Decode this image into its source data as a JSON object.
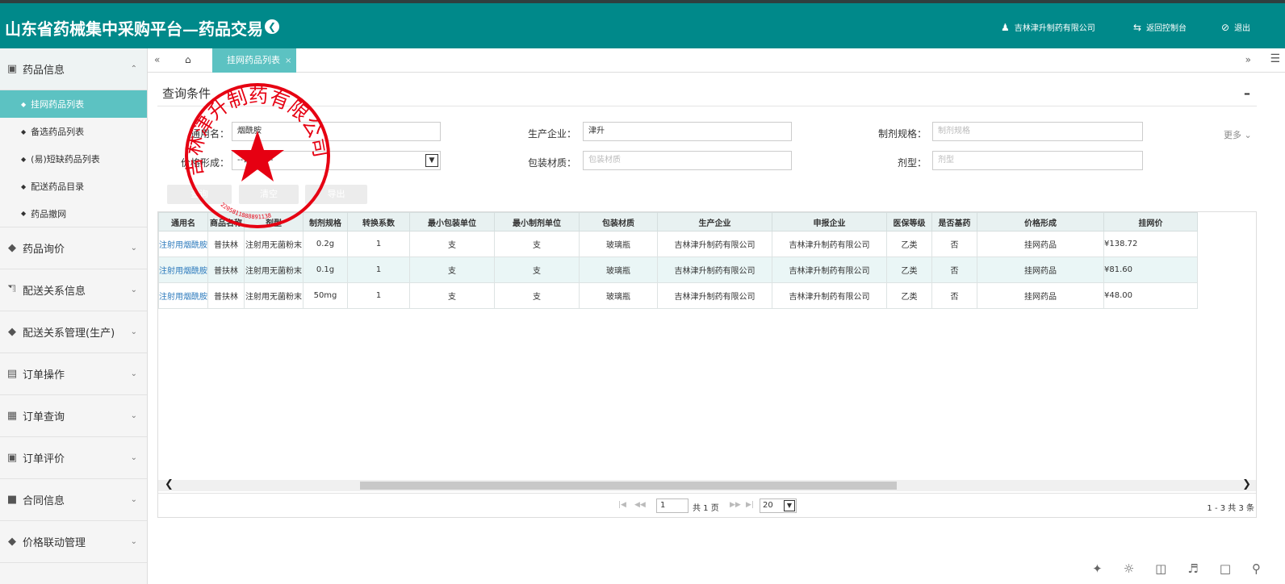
{
  "header": {
    "title": "山东省药械集中采购平台—药品交易",
    "company": "吉林津升制药有限公司",
    "control_label": "返回控制台",
    "logout_label": "退出"
  },
  "sidebar": {
    "groups": [
      {
        "label": "药品信息",
        "icon": "briefcase-icon",
        "subitems": [
          "挂网药品列表",
          "备选药品列表",
          "(易)短缺药品列表",
          "配送药品目录",
          "药品撤网"
        ]
      },
      {
        "label": "药品询价",
        "icon": "diamond-icon"
      },
      {
        "label": "配送关系信息",
        "icon": "truck-icon"
      },
      {
        "label": "配送关系管理(生产)",
        "icon": "diamond-icon"
      },
      {
        "label": "订单操作",
        "icon": "list-icon"
      },
      {
        "label": "订单查询",
        "icon": "search-doc-icon"
      },
      {
        "label": "订单评价",
        "icon": "briefcase-icon"
      },
      {
        "label": "合同信息",
        "icon": "book-icon"
      },
      {
        "label": "价格联动管理",
        "icon": "diamond-icon"
      }
    ]
  },
  "tabs": {
    "active_label": "挂网药品列表"
  },
  "query": {
    "title": "查询条件",
    "more_label": "更多",
    "fields": {
      "generic_name": {
        "label": "通用名：",
        "value": "烟酰胺"
      },
      "manufacturer": {
        "label": "生产企业：",
        "value": "津升"
      },
      "spec": {
        "label": "制剂规格：",
        "placeholder": "制剂规格"
      },
      "price_form": {
        "label": "价格形成：",
        "value": "--请选择--"
      },
      "packaging": {
        "label": "包装材质：",
        "placeholder": "包装材质"
      },
      "dosage_form": {
        "label": "剂型：",
        "placeholder": "剂型"
      }
    },
    "buttons": {
      "search": "查询",
      "clear": "清空",
      "export": "导出"
    }
  },
  "table": {
    "headers": [
      "通用名",
      "商品名称",
      "剂型",
      "制剂规格",
      "转换系数",
      "最小包装单位",
      "最小制剂单位",
      "包装材质",
      "生产企业",
      "申报企业",
      "医保等级",
      "是否基药",
      "价格形成",
      "挂网价"
    ],
    "rows": [
      [
        "注射用烟酰胺",
        "普扶林",
        "注射用无菌粉末",
        "0.2g",
        "1",
        "支",
        "支",
        "玻璃瓶",
        "吉林津升制药有限公司",
        "吉林津升制药有限公司",
        "乙类",
        "否",
        "挂网药品",
        "¥138.72"
      ],
      [
        "注射用烟酰胺",
        "普扶林",
        "注射用无菌粉末",
        "0.1g",
        "1",
        "支",
        "支",
        "玻璃瓶",
        "吉林津升制药有限公司",
        "吉林津升制药有限公司",
        "乙类",
        "否",
        "挂网药品",
        "¥81.60"
      ],
      [
        "注射用烟酰胺",
        "普扶林",
        "注射用无菌粉末",
        "50mg",
        "1",
        "支",
        "支",
        "玻璃瓶",
        "吉林津升制药有限公司",
        "吉林津升制药有限公司",
        "乙类",
        "否",
        "挂网药品",
        "¥48.00"
      ]
    ]
  },
  "pager": {
    "page": "1",
    "total_pages": "共 1 页",
    "page_size": "20",
    "range": "1 - 3  共 3 条"
  },
  "seal": {
    "text": "吉林津升制药有限公司",
    "number": "2205811888891138",
    "color": "#e60012"
  },
  "colors": {
    "brand": "#00898a",
    "accent": "#5cc2c2",
    "link": "#2e7bbd"
  }
}
